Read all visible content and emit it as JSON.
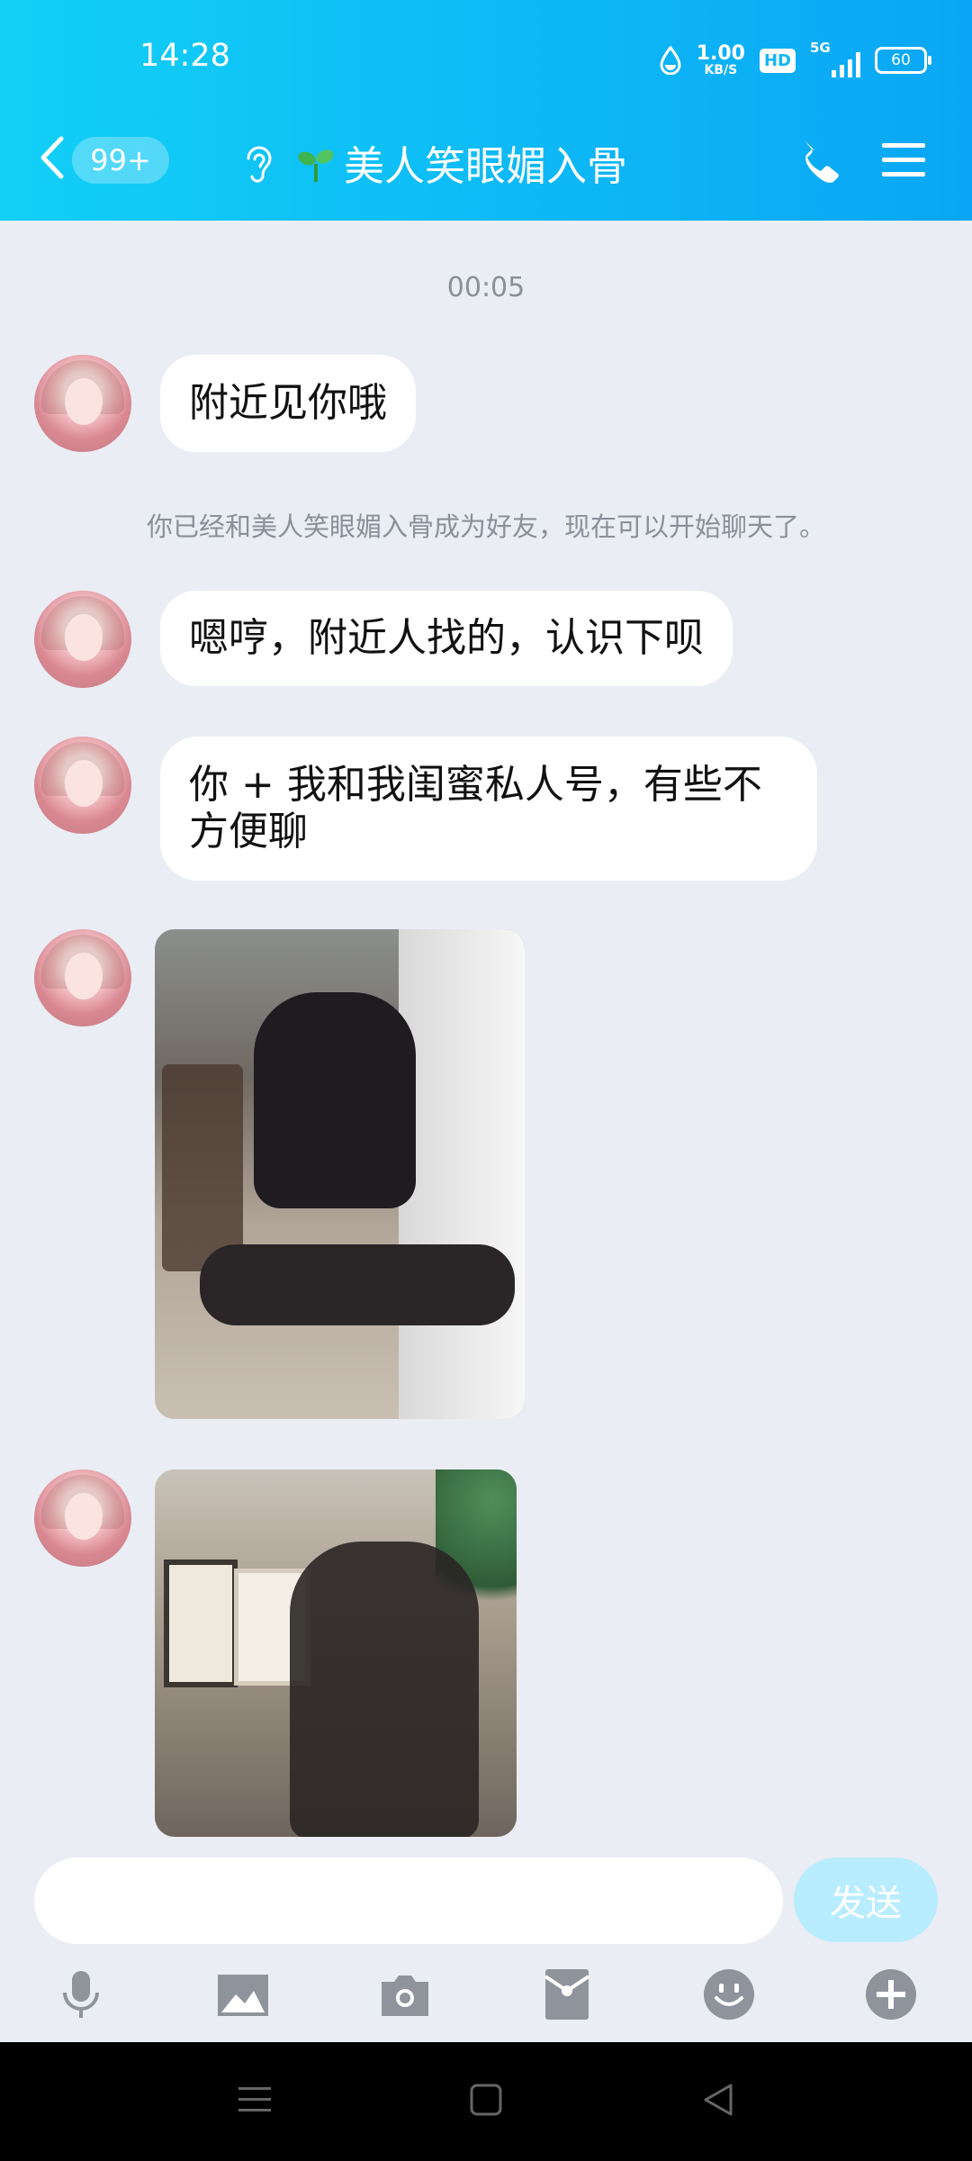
{
  "status_bar": {
    "time": "14:28",
    "net_speed_value": "1.00",
    "net_speed_unit": "KB/S",
    "hd_label": "HD",
    "network_label": "5G",
    "battery": "60"
  },
  "header": {
    "unread_count": "99+",
    "title": "美人笑眼媚入骨",
    "icons": [
      "back-icon",
      "ear-icon",
      "sprout-icon",
      "phone-icon",
      "menu-icon"
    ]
  },
  "messages": {
    "timestamp": "00:05",
    "msg1": "附近见你哦",
    "system_notice": "你已经和美人笑眼媚入骨成为好友，现在可以开始聊天了。",
    "msg2": "嗯哼，附近人找的，认识下呗",
    "msg3": "你 + 我和我闺蜜私人号，有些不\n方便聊"
  },
  "composer": {
    "input_value": "",
    "send_label": "发送"
  },
  "toolbar": {
    "icons": [
      "microphone-icon",
      "image-icon",
      "camera-icon",
      "red-packet-icon",
      "emoji-icon",
      "plus-icon"
    ]
  },
  "colors": {
    "header_start": "#12d0f6",
    "header_end": "#0aa6f5",
    "background": "#eaedf4",
    "send_button": "#b8ecff",
    "icon_gray": "#8f949c"
  }
}
